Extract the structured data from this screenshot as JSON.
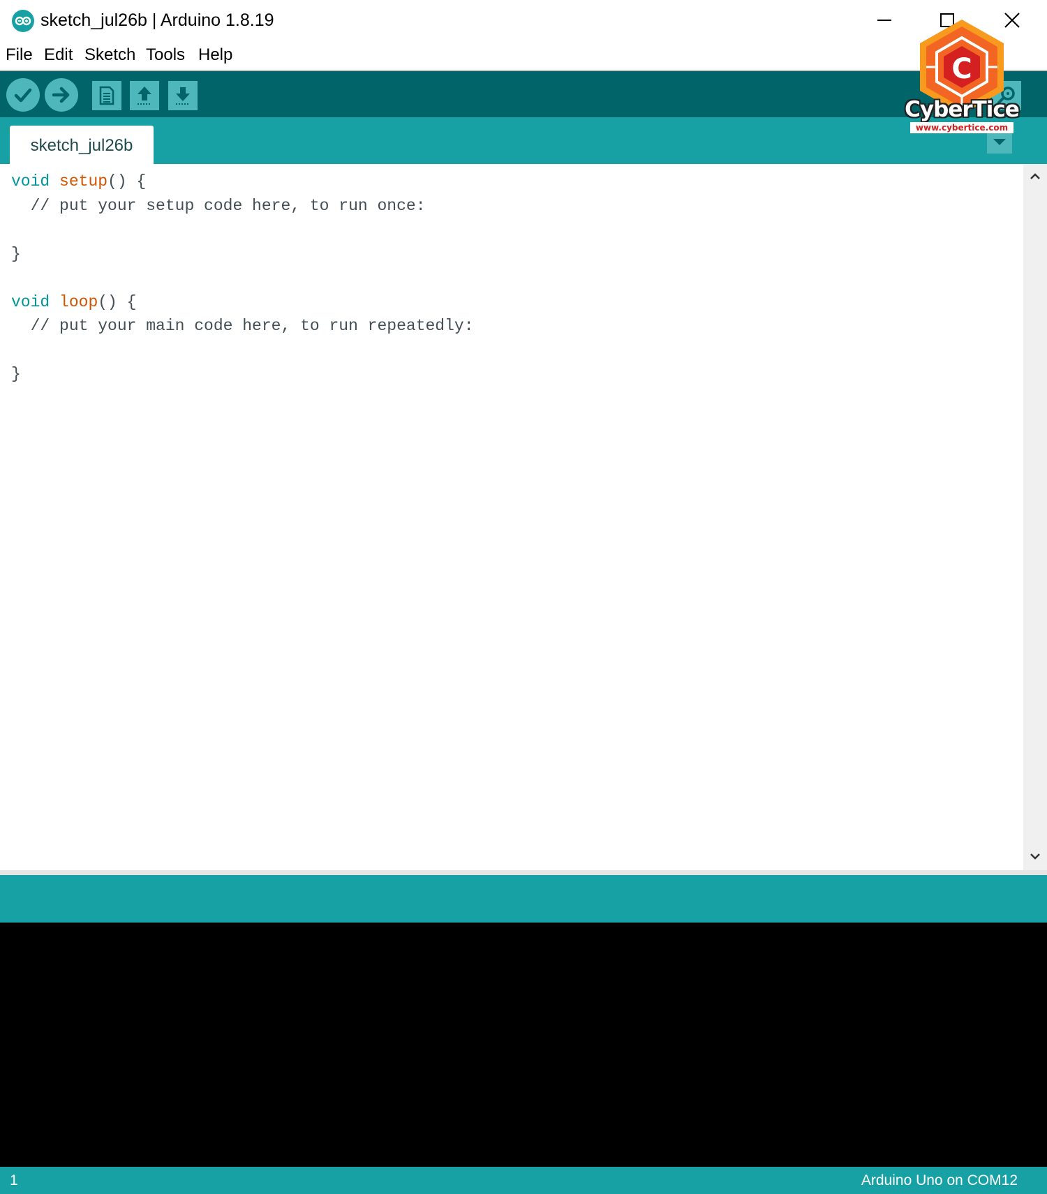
{
  "window": {
    "title": "sketch_jul26b | Arduino 1.8.19"
  },
  "menu": {
    "items": [
      "File",
      "Edit",
      "Sketch",
      "Tools",
      "Help"
    ]
  },
  "toolbar": {
    "buttons": [
      {
        "name": "verify",
        "icon": "check-icon"
      },
      {
        "name": "upload",
        "icon": "arrow-right-icon"
      },
      {
        "name": "new",
        "icon": "document-icon"
      },
      {
        "name": "open",
        "icon": "arrow-up-icon"
      },
      {
        "name": "save",
        "icon": "arrow-down-icon"
      },
      {
        "name": "serial-monitor",
        "icon": "magnifier-icon"
      }
    ]
  },
  "tabs": [
    {
      "label": "sketch_jul26b",
      "active": true
    }
  ],
  "editor": {
    "lines": [
      {
        "k": "void",
        "f": "setup",
        "r": "() {"
      },
      {
        "c": "  // put your setup code here, to run once:"
      },
      {
        "c": ""
      },
      {
        "c": "}"
      },
      {
        "c": ""
      },
      {
        "k": "void",
        "f": "loop",
        "r": "() {"
      },
      {
        "c": "  // put your main code here, to run repeatedly:"
      },
      {
        "c": ""
      },
      {
        "c": "}"
      }
    ]
  },
  "status": {
    "line_number": "1",
    "board": "Arduino Uno on COM12"
  },
  "watermark": {
    "letter": "C",
    "name": "CyberTice",
    "url": "www.cybertice.com"
  },
  "colors": {
    "teal_dark": "#006468",
    "teal": "#17a1a5",
    "button": "#4db7bb",
    "keyword": "#00979c",
    "function": "#d35400",
    "logo_orange": "#f26522",
    "logo_red": "#d42020"
  }
}
